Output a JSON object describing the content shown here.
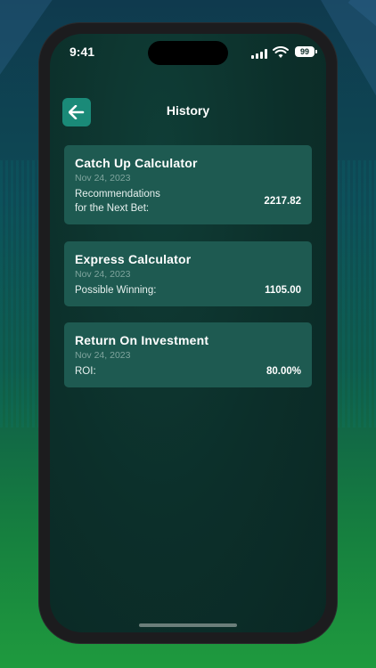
{
  "status_bar": {
    "time": "9:41",
    "battery": "99"
  },
  "header": {
    "title": "History",
    "back_icon": "arrow-left-icon"
  },
  "history": [
    {
      "title": "Catch Up Calculator",
      "date": "Nov 24, 2023",
      "label_line1": "Recommendations",
      "label_line2": "for the Next Bet:",
      "value": "2217.82"
    },
    {
      "title": "Express Calculator",
      "date": "Nov 24, 2023",
      "label_line1": "Possible Winning:",
      "value": "1105.00"
    },
    {
      "title": "Return On Investment",
      "date": "Nov 24, 2023",
      "label_line1": "ROI:",
      "value": "80.00%"
    }
  ],
  "colors": {
    "accent": "#1a8a78",
    "card": "#1e5a51",
    "screen_bg": "#0c2f2a"
  }
}
